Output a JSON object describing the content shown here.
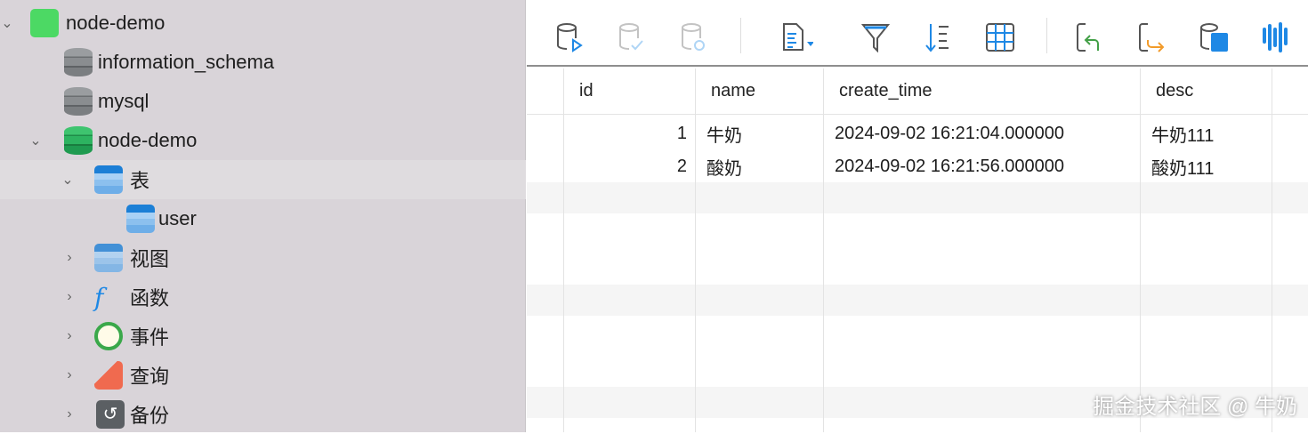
{
  "sidebar": {
    "connection": "node-demo",
    "databases": [
      "information_schema",
      "mysql",
      "node-demo"
    ],
    "groups": {
      "tables": "表",
      "views": "视图",
      "functions": "函数",
      "events": "事件",
      "queries": "查询",
      "backups": "备份"
    },
    "tables": [
      "user"
    ]
  },
  "toolbar": {
    "icons": [
      "db-run-icon",
      "db-commit-icon",
      "db-rollback-icon",
      "text-format-icon",
      "filter-icon",
      "sort-icon",
      "grid-view-icon",
      "import-icon",
      "export-icon",
      "data-generation-icon",
      "profile-icon"
    ]
  },
  "grid": {
    "columns": [
      "id",
      "name",
      "create_time",
      "desc"
    ],
    "rows": [
      {
        "id": "1",
        "name": "牛奶",
        "create_time": "2024-09-02 16:21:04.000000",
        "desc": "牛奶111"
      },
      {
        "id": "2",
        "name": "酸奶",
        "create_time": "2024-09-02 16:21:56.000000",
        "desc": "酸奶111"
      }
    ]
  },
  "watermark": "掘金技术社区 @ 牛奶"
}
